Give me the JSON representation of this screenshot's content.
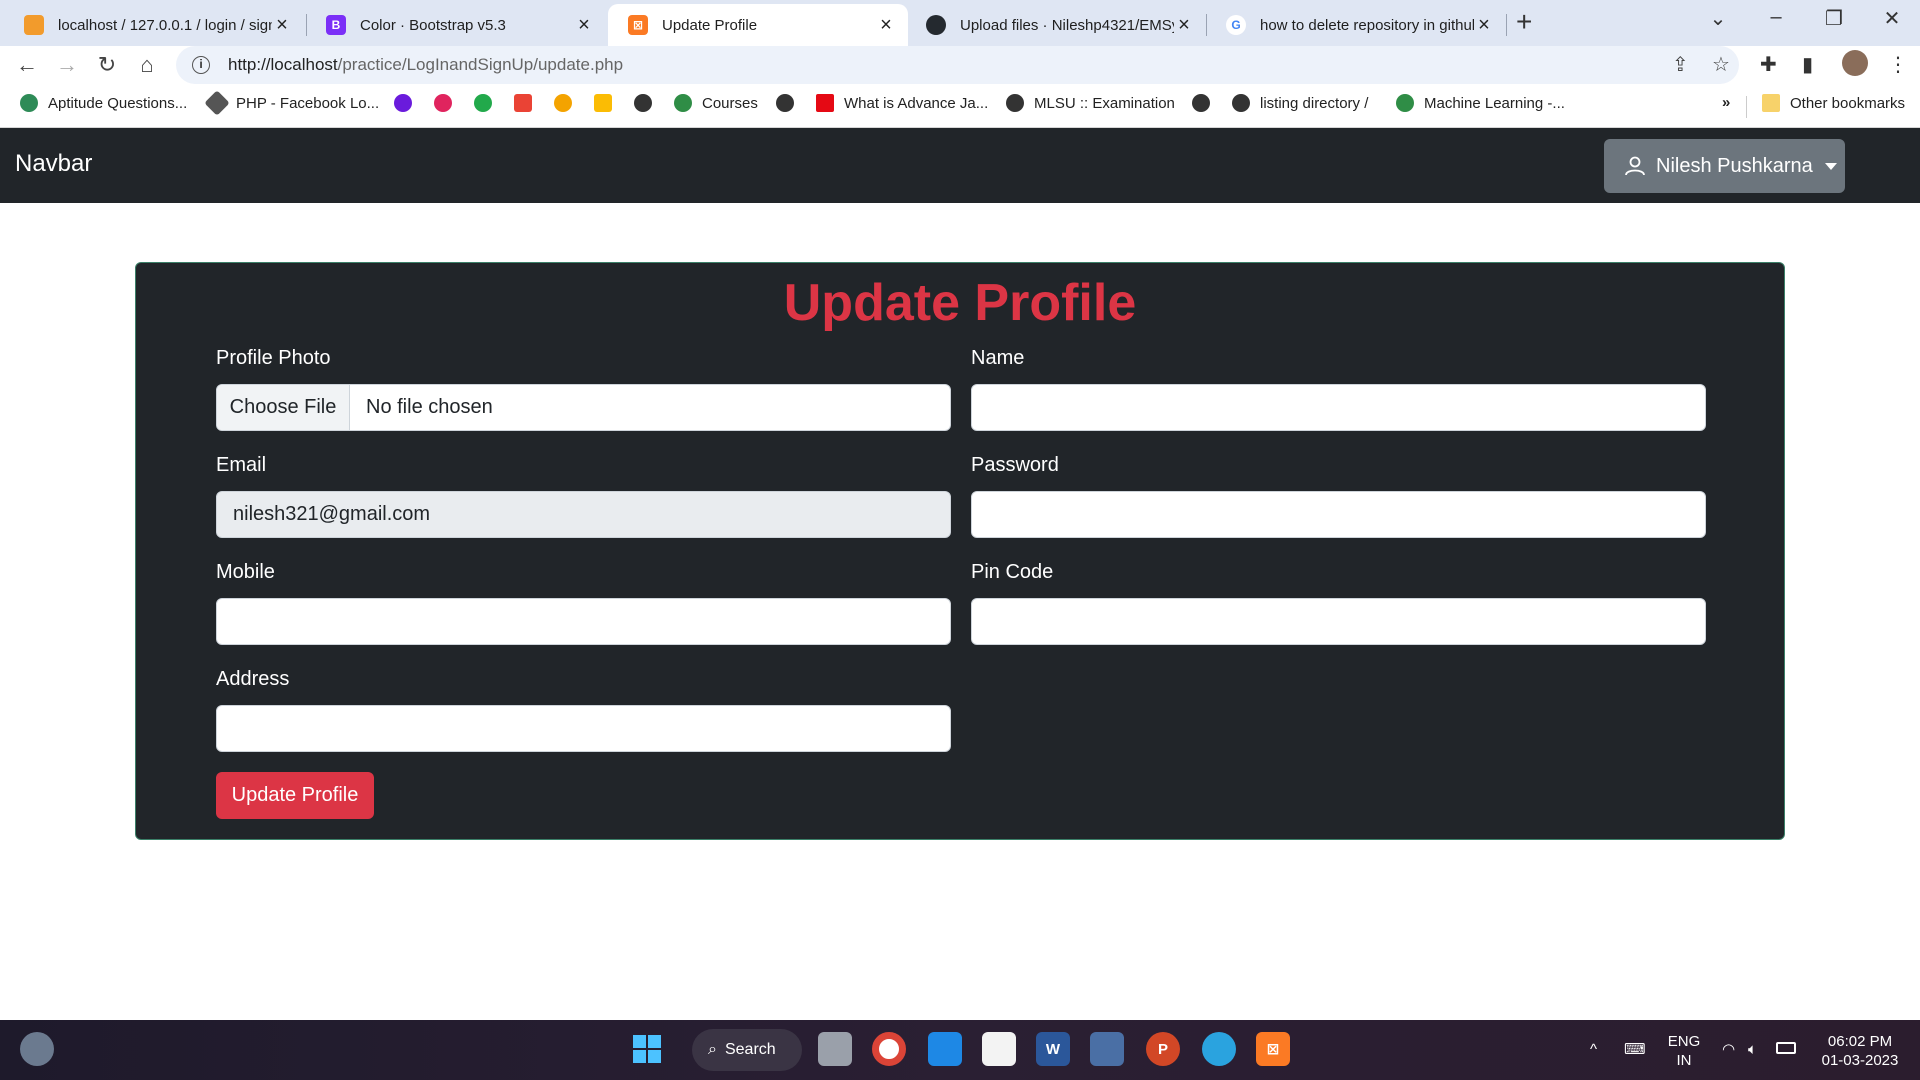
{
  "browser": {
    "tabs": [
      {
        "title": "localhost / 127.0.0.1 / login / sign",
        "favicon": "phpmyadmin-icon"
      },
      {
        "title": "Color · Bootstrap v5.3",
        "favicon": "bootstrap-icon"
      },
      {
        "title": "Update Profile",
        "favicon": "xampp-icon",
        "active": true
      },
      {
        "title": "Upload files · Nileshp4321/EMSys",
        "favicon": "github-icon"
      },
      {
        "title": "how to delete repository in github",
        "favicon": "google-icon"
      }
    ],
    "url_host": "http://localhost",
    "url_path": "/practice/LogInandSignUp/update.php",
    "bookmarks": [
      "Aptitude Questions...",
      "PHP - Facebook Lo...",
      "Courses",
      "What is Advance Ja...",
      "MLSU :: Examination",
      "listing directory /",
      "Machine Learning -..."
    ],
    "more_bookmarks": "»",
    "other_bookmarks": "Other bookmarks"
  },
  "navbar": {
    "brand": "Navbar",
    "user_name": "Nilesh Pushkarna"
  },
  "form": {
    "title": "Update Profile",
    "profile_photo_label": "Profile Photo",
    "choose_file": "Choose File",
    "no_file": "No file chosen",
    "name_label": "Name",
    "name_value": "",
    "email_label": "Email",
    "email_value": "nilesh321@gmail.com",
    "password_label": "Password",
    "password_value": "",
    "mobile_label": "Mobile",
    "mobile_value": "",
    "pincode_label": "Pin Code",
    "pincode_value": "",
    "address_label": "Address",
    "address_value": "",
    "submit_label": "Update Profile"
  },
  "taskbar": {
    "search_label": "Search",
    "lang_top": "ENG",
    "lang_bottom": "IN",
    "time": "06:02 PM",
    "date": "01-03-2023"
  },
  "colors": {
    "danger": "#dc3545",
    "dark": "#212529",
    "secondary": "#6c757d"
  }
}
